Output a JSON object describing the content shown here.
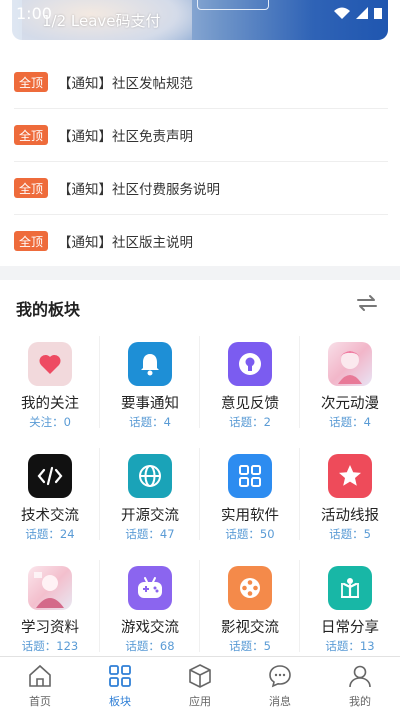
{
  "status_bar": {
    "time": "1:00"
  },
  "banner": {
    "caption": "1/2 Leave码支付"
  },
  "notices": [
    {
      "badge": "全顶",
      "text": "【通知】社区发帖规范"
    },
    {
      "badge": "全顶",
      "text": "【通知】社区免责声明"
    },
    {
      "badge": "全顶",
      "text": "【通知】社区付费服务说明"
    },
    {
      "badge": "全顶",
      "text": "【通知】社区版主说明"
    }
  ],
  "boards_section": {
    "title": "我的板块",
    "items": [
      {
        "name": "我的关注",
        "count": "关注：0",
        "icon": "heart-icon",
        "color": "#f2d9dc"
      },
      {
        "name": "要事通知",
        "count": "话题：4",
        "icon": "bell-icon",
        "color": "#1e8fd6"
      },
      {
        "name": "意见反馈",
        "count": "话题：2",
        "icon": "lightbulb-icon",
        "color": "#7b5cf0"
      },
      {
        "name": "次元动漫",
        "count": "话题：4",
        "icon": "anime-thumbnail-icon",
        "color": "#f4c9d6"
      },
      {
        "name": "技术交流",
        "count": "话题：24",
        "icon": "code-icon",
        "color": "#111111"
      },
      {
        "name": "开源交流",
        "count": "话题：47",
        "icon": "globe-icon",
        "color": "#1aa3b8"
      },
      {
        "name": "实用软件",
        "count": "话题：50",
        "icon": "apps-grid-icon",
        "color": "#2d8cf0"
      },
      {
        "name": "活动线报",
        "count": "话题：5",
        "icon": "star-icon",
        "color": "#ee4b5a"
      },
      {
        "name": "学习资料",
        "count": "话题：123",
        "icon": "study-thumbnail-icon",
        "color": "#f6d3dc"
      },
      {
        "name": "游戏交流",
        "count": "话题：68",
        "icon": "gamepad-icon",
        "color": "#8b65ef"
      },
      {
        "name": "影视交流",
        "count": "话题：5",
        "icon": "film-reel-icon",
        "color": "#f48a4a"
      },
      {
        "name": "日常分享",
        "count": "话题：13",
        "icon": "daily-person-icon",
        "color": "#18b7a6"
      }
    ]
  },
  "tabbar": {
    "items": [
      {
        "label": "首页",
        "icon": "home-icon"
      },
      {
        "label": "板块",
        "icon": "grid-icon",
        "active": true
      },
      {
        "label": "应用",
        "icon": "cube-icon"
      },
      {
        "label": "消息",
        "icon": "chat-icon"
      },
      {
        "label": "我的",
        "icon": "user-icon"
      }
    ],
    "active_color": "#2f7fd6"
  }
}
